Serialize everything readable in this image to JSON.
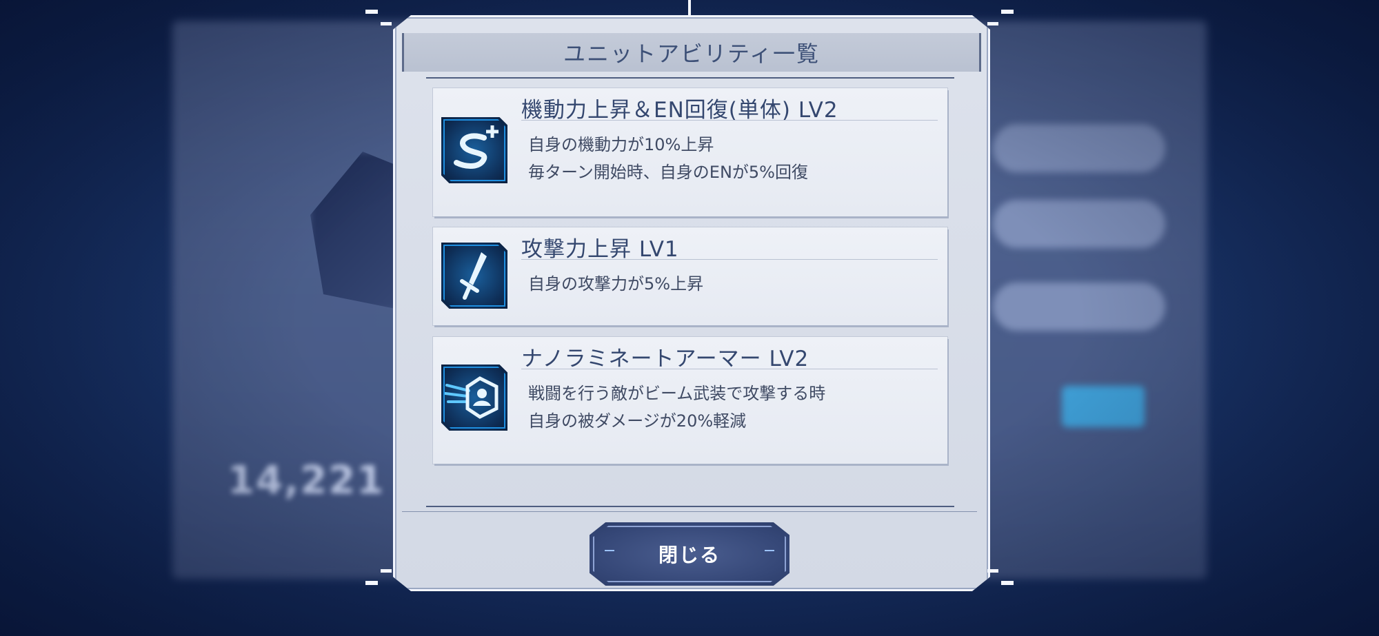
{
  "dialog": {
    "title": "ユニットアビリティ一覧",
    "close_label": "閉じる"
  },
  "abilities": [
    {
      "name": "機動力上昇＆EN回復(単体) LV2",
      "icon": "speed-up-icon",
      "lines": [
        "自身の機動力が10%上昇",
        "毎ターン開始時、自身のENが5%回復"
      ]
    },
    {
      "name": "攻撃力上昇 LV1",
      "icon": "sword-icon",
      "lines": [
        "自身の攻撃力が5%上昇"
      ]
    },
    {
      "name": "ナノラミネートアーマー LV2",
      "icon": "armor-shield-icon",
      "lines": [
        "戦闘を行う敵がビーム武装で攻撃する時",
        "自身の被ダメージが20%軽減"
      ]
    }
  ],
  "background": {
    "power_value": "14,221"
  },
  "colors": {
    "accent": "#1f8fe0",
    "title_text": "#3d5077",
    "button_bg": "#354777"
  }
}
